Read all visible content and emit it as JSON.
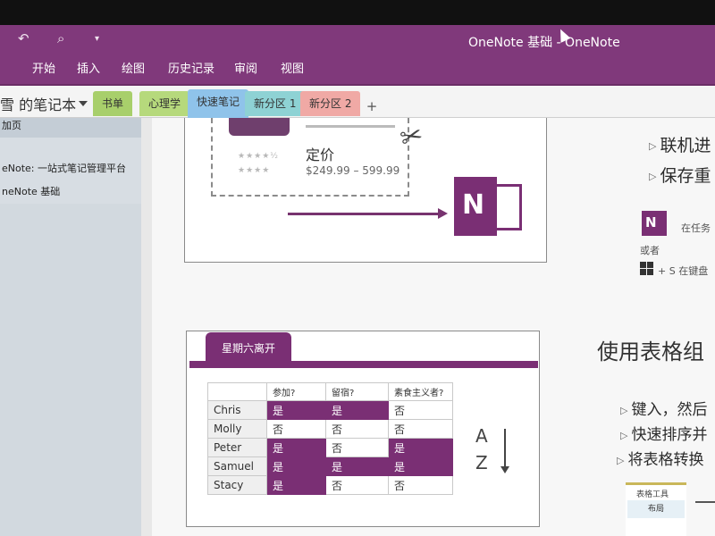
{
  "window": {
    "title": "OneNote 基础  -  OneNote"
  },
  "quick_access": {
    "undo_icon": "undo-icon",
    "touch_icon": "touch-mode-icon",
    "customize_icon": "customize-dropdown-icon"
  },
  "ribbon": {
    "tabs": [
      {
        "label": "开始"
      },
      {
        "label": "插入"
      },
      {
        "label": "绘图"
      },
      {
        "label": "历史记录"
      },
      {
        "label": "审阅"
      },
      {
        "label": "视图"
      }
    ]
  },
  "notebook": {
    "name": "雪 的笔记本",
    "sections": [
      {
        "label": "书单",
        "color": "#a8cf6b"
      },
      {
        "label": "心理学",
        "color": "#b6d97c"
      },
      {
        "label": "快速笔记",
        "color": "#8fc3ea"
      },
      {
        "label": "新分区 1",
        "color": "#8ed2d4"
      },
      {
        "label": "新分区 2",
        "color": "#f0a9a5"
      }
    ],
    "add_section": "+"
  },
  "pages": {
    "add_label": "加页",
    "items": [
      {
        "label": "eNote: 一站式笔记管理平台"
      },
      {
        "label": "neNote 基础"
      }
    ]
  },
  "content": {
    "card1": {
      "stars_1": "★★★★½",
      "stars_2": "★★★★",
      "price_label": "定价",
      "price_value": "$249.99 – 599.99",
      "onenote_letter": "N"
    },
    "right_column": {
      "bullets_top": [
        {
          "text": "联机进"
        },
        {
          "text": "保存重"
        }
      ],
      "small_icon_letter": "N",
      "taskbar_text": "在任务",
      "or_text": "或者",
      "shortcut_text": "+ S  在键盘",
      "heading": "使用表格组",
      "bullets_bottom": [
        {
          "text": "键入，然后"
        },
        {
          "text": "快速排序并"
        },
        {
          "text": "将表格转换"
        }
      ]
    },
    "card2": {
      "tab_label": "星期六离开",
      "table": {
        "headers": [
          "参加?",
          "留宿?",
          "素食主义者?"
        ],
        "rows": [
          {
            "name": "Chris",
            "values": [
              "是",
              "是",
              "否"
            ]
          },
          {
            "name": "Molly",
            "values": [
              "否",
              "否",
              "否"
            ]
          },
          {
            "name": "Peter",
            "values": [
              "是",
              "否",
              "是"
            ]
          },
          {
            "name": "Samuel",
            "values": [
              "是",
              "是",
              "是"
            ]
          },
          {
            "name": "Stacy",
            "values": [
              "是",
              "否",
              "否"
            ]
          }
        ]
      },
      "sort_a": "A",
      "sort_z": "Z"
    },
    "table_tools": {
      "label": "表格工具",
      "layout_tab": "布局"
    }
  },
  "colors": {
    "onenote_purple": "#80397b",
    "table_highlight": "#7a2f74"
  }
}
